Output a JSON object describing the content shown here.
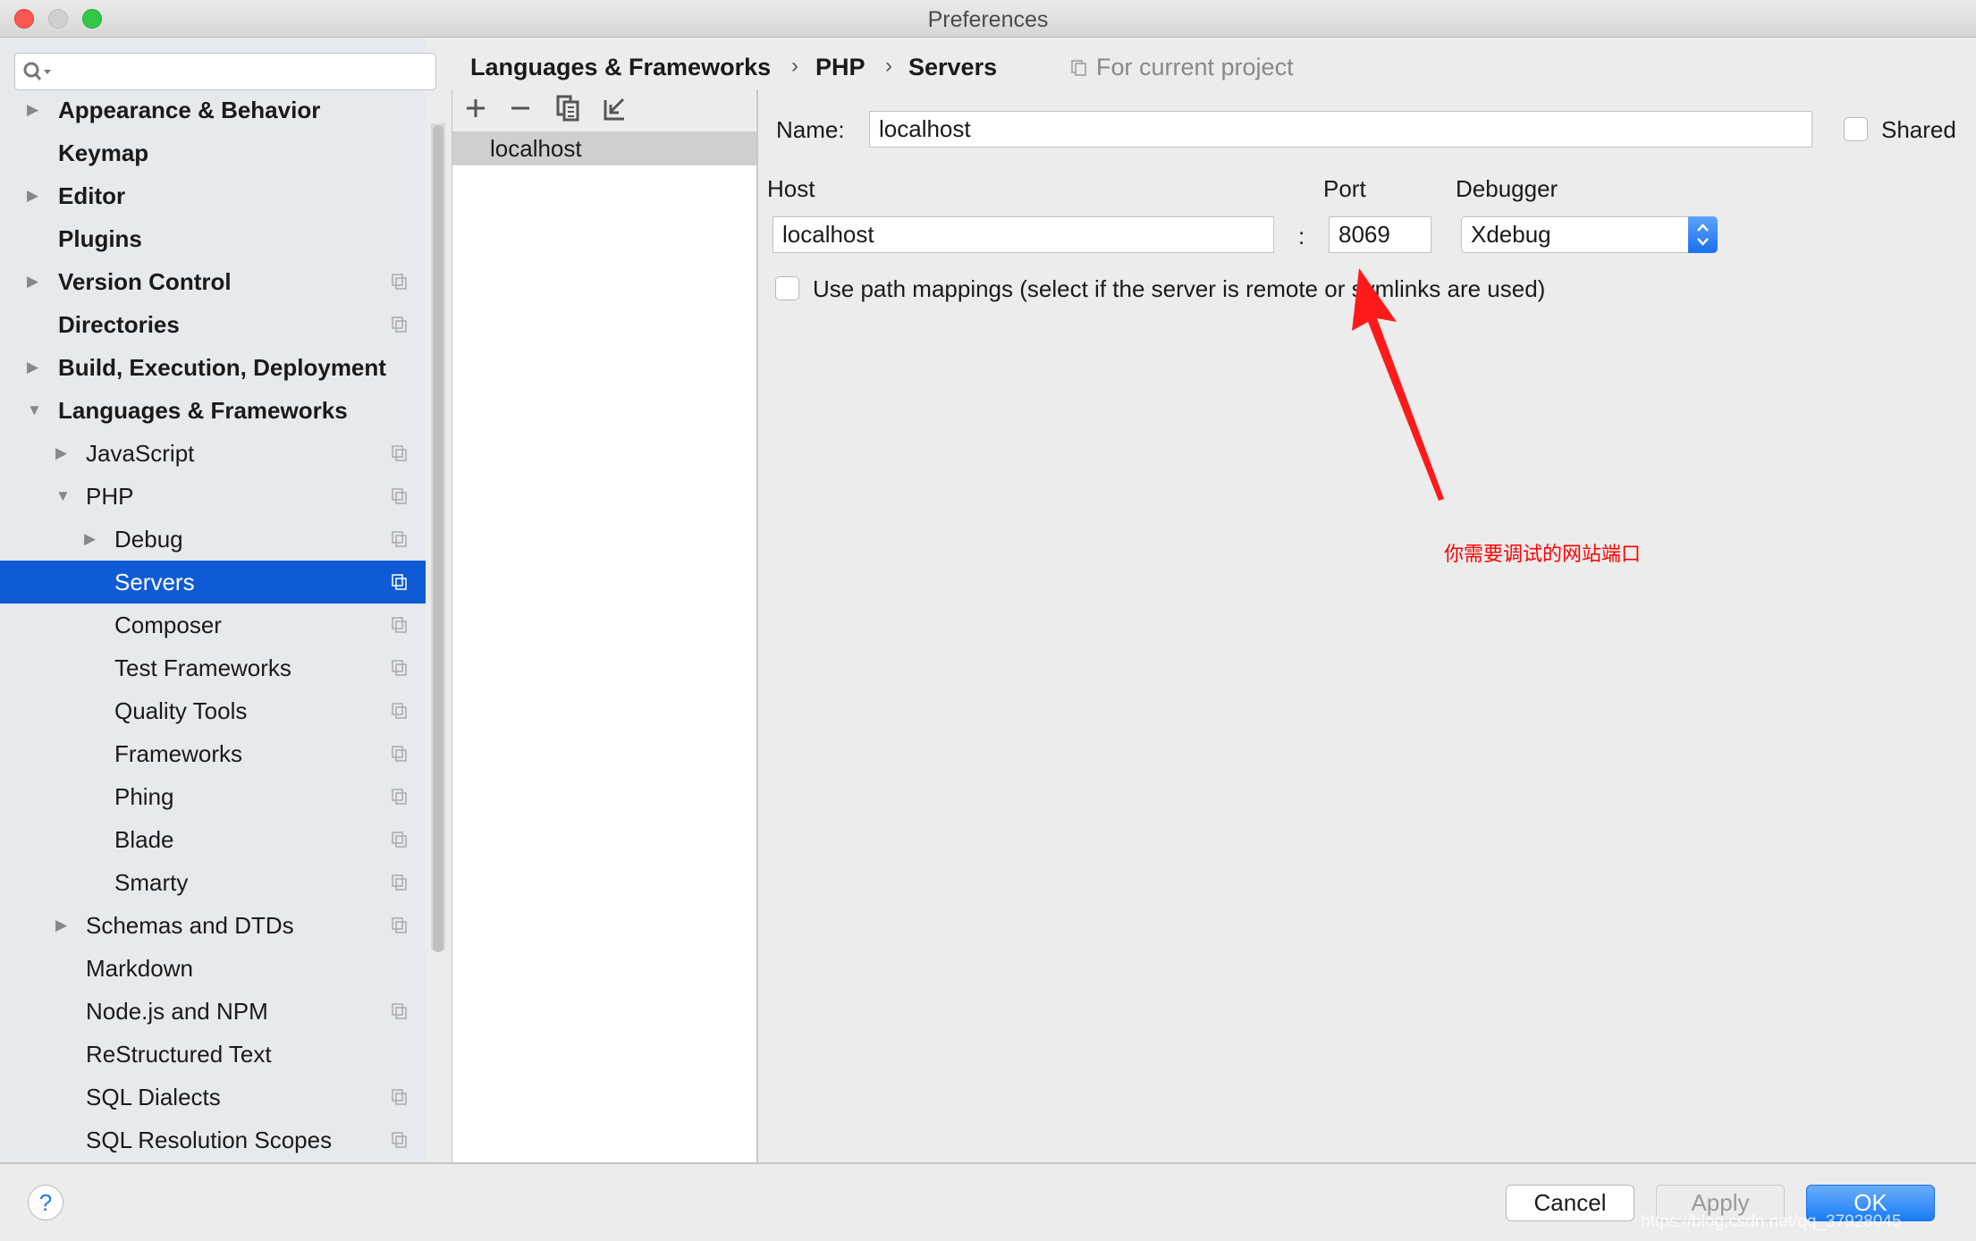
{
  "window": {
    "title": "Preferences"
  },
  "search": {
    "placeholder": ""
  },
  "sidebar": {
    "items": [
      {
        "label": "Appearance & Behavior",
        "level": 0,
        "bold": true,
        "arrow": "right",
        "copy": false
      },
      {
        "label": "Keymap",
        "level": 0,
        "bold": true,
        "arrow": "",
        "copy": false
      },
      {
        "label": "Editor",
        "level": 0,
        "bold": true,
        "arrow": "right",
        "copy": false
      },
      {
        "label": "Plugins",
        "level": 0,
        "bold": true,
        "arrow": "",
        "copy": false
      },
      {
        "label": "Version Control",
        "level": 0,
        "bold": true,
        "arrow": "right",
        "copy": true
      },
      {
        "label": "Directories",
        "level": 0,
        "bold": true,
        "arrow": "",
        "copy": true
      },
      {
        "label": "Build, Execution, Deployment",
        "level": 0,
        "bold": true,
        "arrow": "right",
        "copy": false
      },
      {
        "label": "Languages & Frameworks",
        "level": 0,
        "bold": true,
        "arrow": "down",
        "copy": false
      },
      {
        "label": "JavaScript",
        "level": 1,
        "arrow": "right",
        "copy": true
      },
      {
        "label": "PHP",
        "level": 1,
        "arrow": "down",
        "copy": true
      },
      {
        "label": "Debug",
        "level": 2,
        "arrow": "right",
        "copy": true
      },
      {
        "label": "Servers",
        "level": 2,
        "arrow": "",
        "copy": true,
        "selected": true
      },
      {
        "label": "Composer",
        "level": 2,
        "arrow": "",
        "copy": true
      },
      {
        "label": "Test Frameworks",
        "level": 2,
        "arrow": "",
        "copy": true
      },
      {
        "label": "Quality Tools",
        "level": 2,
        "arrow": "",
        "copy": true
      },
      {
        "label": "Frameworks",
        "level": 2,
        "arrow": "",
        "copy": true
      },
      {
        "label": "Phing",
        "level": 2,
        "arrow": "",
        "copy": true
      },
      {
        "label": "Blade",
        "level": 2,
        "arrow": "",
        "copy": true
      },
      {
        "label": "Smarty",
        "level": 2,
        "arrow": "",
        "copy": true
      },
      {
        "label": "Schemas and DTDs",
        "level": 1,
        "arrow": "right",
        "copy": true
      },
      {
        "label": "Markdown",
        "level": 1,
        "arrow": "",
        "copy": false
      },
      {
        "label": "Node.js and NPM",
        "level": 1,
        "arrow": "",
        "copy": true
      },
      {
        "label": "ReStructured Text",
        "level": 1,
        "arrow": "",
        "copy": false
      },
      {
        "label": "SQL Dialects",
        "level": 1,
        "arrow": "",
        "copy": true
      },
      {
        "label": "SQL Resolution Scopes",
        "level": 1,
        "arrow": "",
        "copy": true
      }
    ]
  },
  "breadcrumb": {
    "items": [
      "Languages & Frameworks",
      "PHP",
      "Servers"
    ],
    "scope": "For current project"
  },
  "servers": {
    "list": [
      "localhost"
    ]
  },
  "form": {
    "name_label": "Name:",
    "name_value": "localhost",
    "shared_label": "Shared",
    "shared_checked": false,
    "host_label": "Host",
    "host_value": "localhost",
    "colon": ":",
    "port_label": "Port",
    "port_value": "8069",
    "debugger_label": "Debugger",
    "debugger_value": "Xdebug",
    "path_mappings_label": "Use path mappings (select if the server is remote or symlinks are used)",
    "path_mappings_checked": false
  },
  "annotation": {
    "text": "你需要调试的网站端口",
    "color": "#ff0000"
  },
  "footer": {
    "help": "?",
    "cancel": "Cancel",
    "apply": "Apply",
    "ok": "OK",
    "watermark": "https://blog.csdn.net/qq_37928045"
  },
  "colors": {
    "accent": "#0f5bd6",
    "ok": "#1a7cf5"
  }
}
